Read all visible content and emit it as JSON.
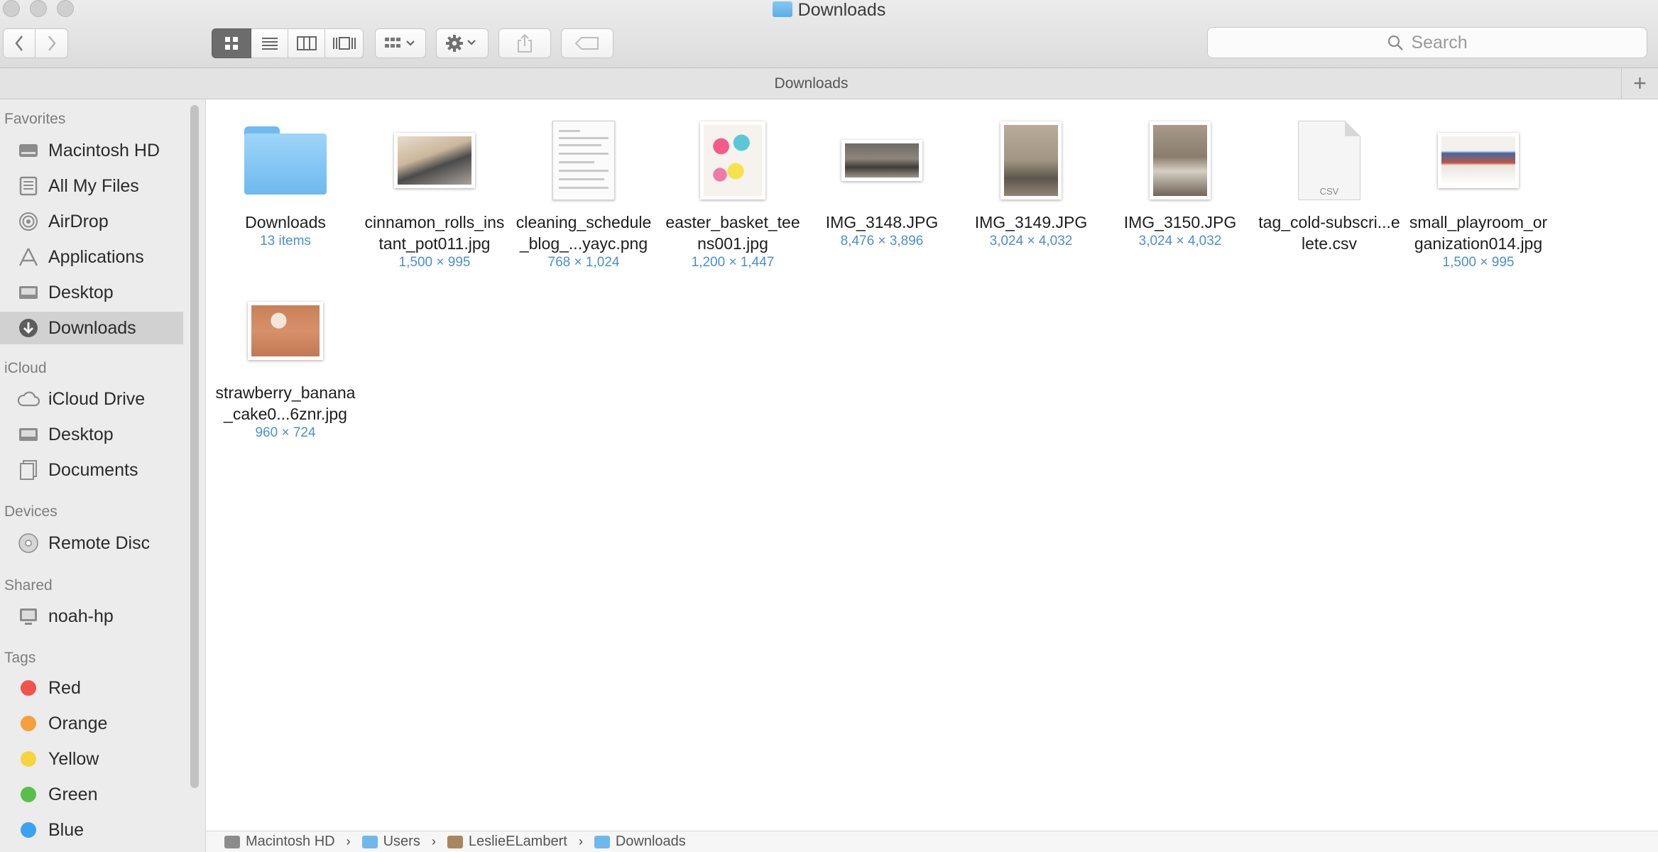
{
  "window": {
    "title": "Downloads",
    "path_header": "Downloads"
  },
  "toolbar": {
    "back_label": "‹",
    "forward_label": "›",
    "search_placeholder": "Search",
    "add_label": "+"
  },
  "sidebar": {
    "favorites_title": "Favorites",
    "favorites": [
      {
        "label": "Macintosh HD",
        "icon": "hard-drive-icon"
      },
      {
        "label": "All My Files",
        "icon": "all-files-icon"
      },
      {
        "label": "AirDrop",
        "icon": "airdrop-icon"
      },
      {
        "label": "Applications",
        "icon": "applications-icon"
      },
      {
        "label": "Desktop",
        "icon": "desktop-icon"
      },
      {
        "label": "Downloads",
        "icon": "downloads-icon",
        "selected": true
      }
    ],
    "icloud_title": "iCloud",
    "icloud": [
      {
        "label": "iCloud Drive",
        "icon": "cloud-icon"
      },
      {
        "label": "Desktop",
        "icon": "desktop-icon"
      },
      {
        "label": "Documents",
        "icon": "documents-icon"
      }
    ],
    "devices_title": "Devices",
    "devices": [
      {
        "label": "Remote Disc",
        "icon": "disc-icon"
      }
    ],
    "shared_title": "Shared",
    "shared": [
      {
        "label": "noah-hp",
        "icon": "computer-icon"
      }
    ],
    "tags_title": "Tags",
    "tags": [
      {
        "label": "Red",
        "color": "#f0524d"
      },
      {
        "label": "Orange",
        "color": "#f5a03c"
      },
      {
        "label": "Yellow",
        "color": "#f7d33c"
      },
      {
        "label": "Green",
        "color": "#56c04a"
      },
      {
        "label": "Blue",
        "color": "#3ca2ef"
      }
    ]
  },
  "files": [
    {
      "name": "Downloads",
      "meta": "13 items",
      "kind": "folder"
    },
    {
      "name": "cinnamon_rolls_instant_pot011.jpg",
      "meta": "1,500 × 995",
      "kind": "photo"
    },
    {
      "name": "cleaning_schedule_blog_...yayc.png",
      "meta": "768 × 1,024",
      "kind": "document"
    },
    {
      "name": "easter_basket_teens001.jpg",
      "meta": "1,200 × 1,447",
      "kind": "photo"
    },
    {
      "name": "IMG_3148.JPG",
      "meta": "8,476 × 3,896",
      "kind": "photo"
    },
    {
      "name": "IMG_3149.JPG",
      "meta": "3,024 × 4,032",
      "kind": "photo"
    },
    {
      "name": "IMG_3150.JPG",
      "meta": "3,024 × 4,032",
      "kind": "photo"
    },
    {
      "name": "tag_cold-subscri...elete.csv",
      "meta": "",
      "kind": "csv",
      "badge": "CSV"
    },
    {
      "name": "small_playroom_organization014.jpg",
      "meta": "1,500 × 995",
      "kind": "photo"
    },
    {
      "name": "strawberry_banana_cake0...6znr.jpg",
      "meta": "960 × 724",
      "kind": "photo"
    }
  ],
  "statusbar": {
    "crumbs": [
      "Macintosh HD",
      "Users",
      "LeslieELambert",
      "Downloads"
    ],
    "separator": "›"
  }
}
